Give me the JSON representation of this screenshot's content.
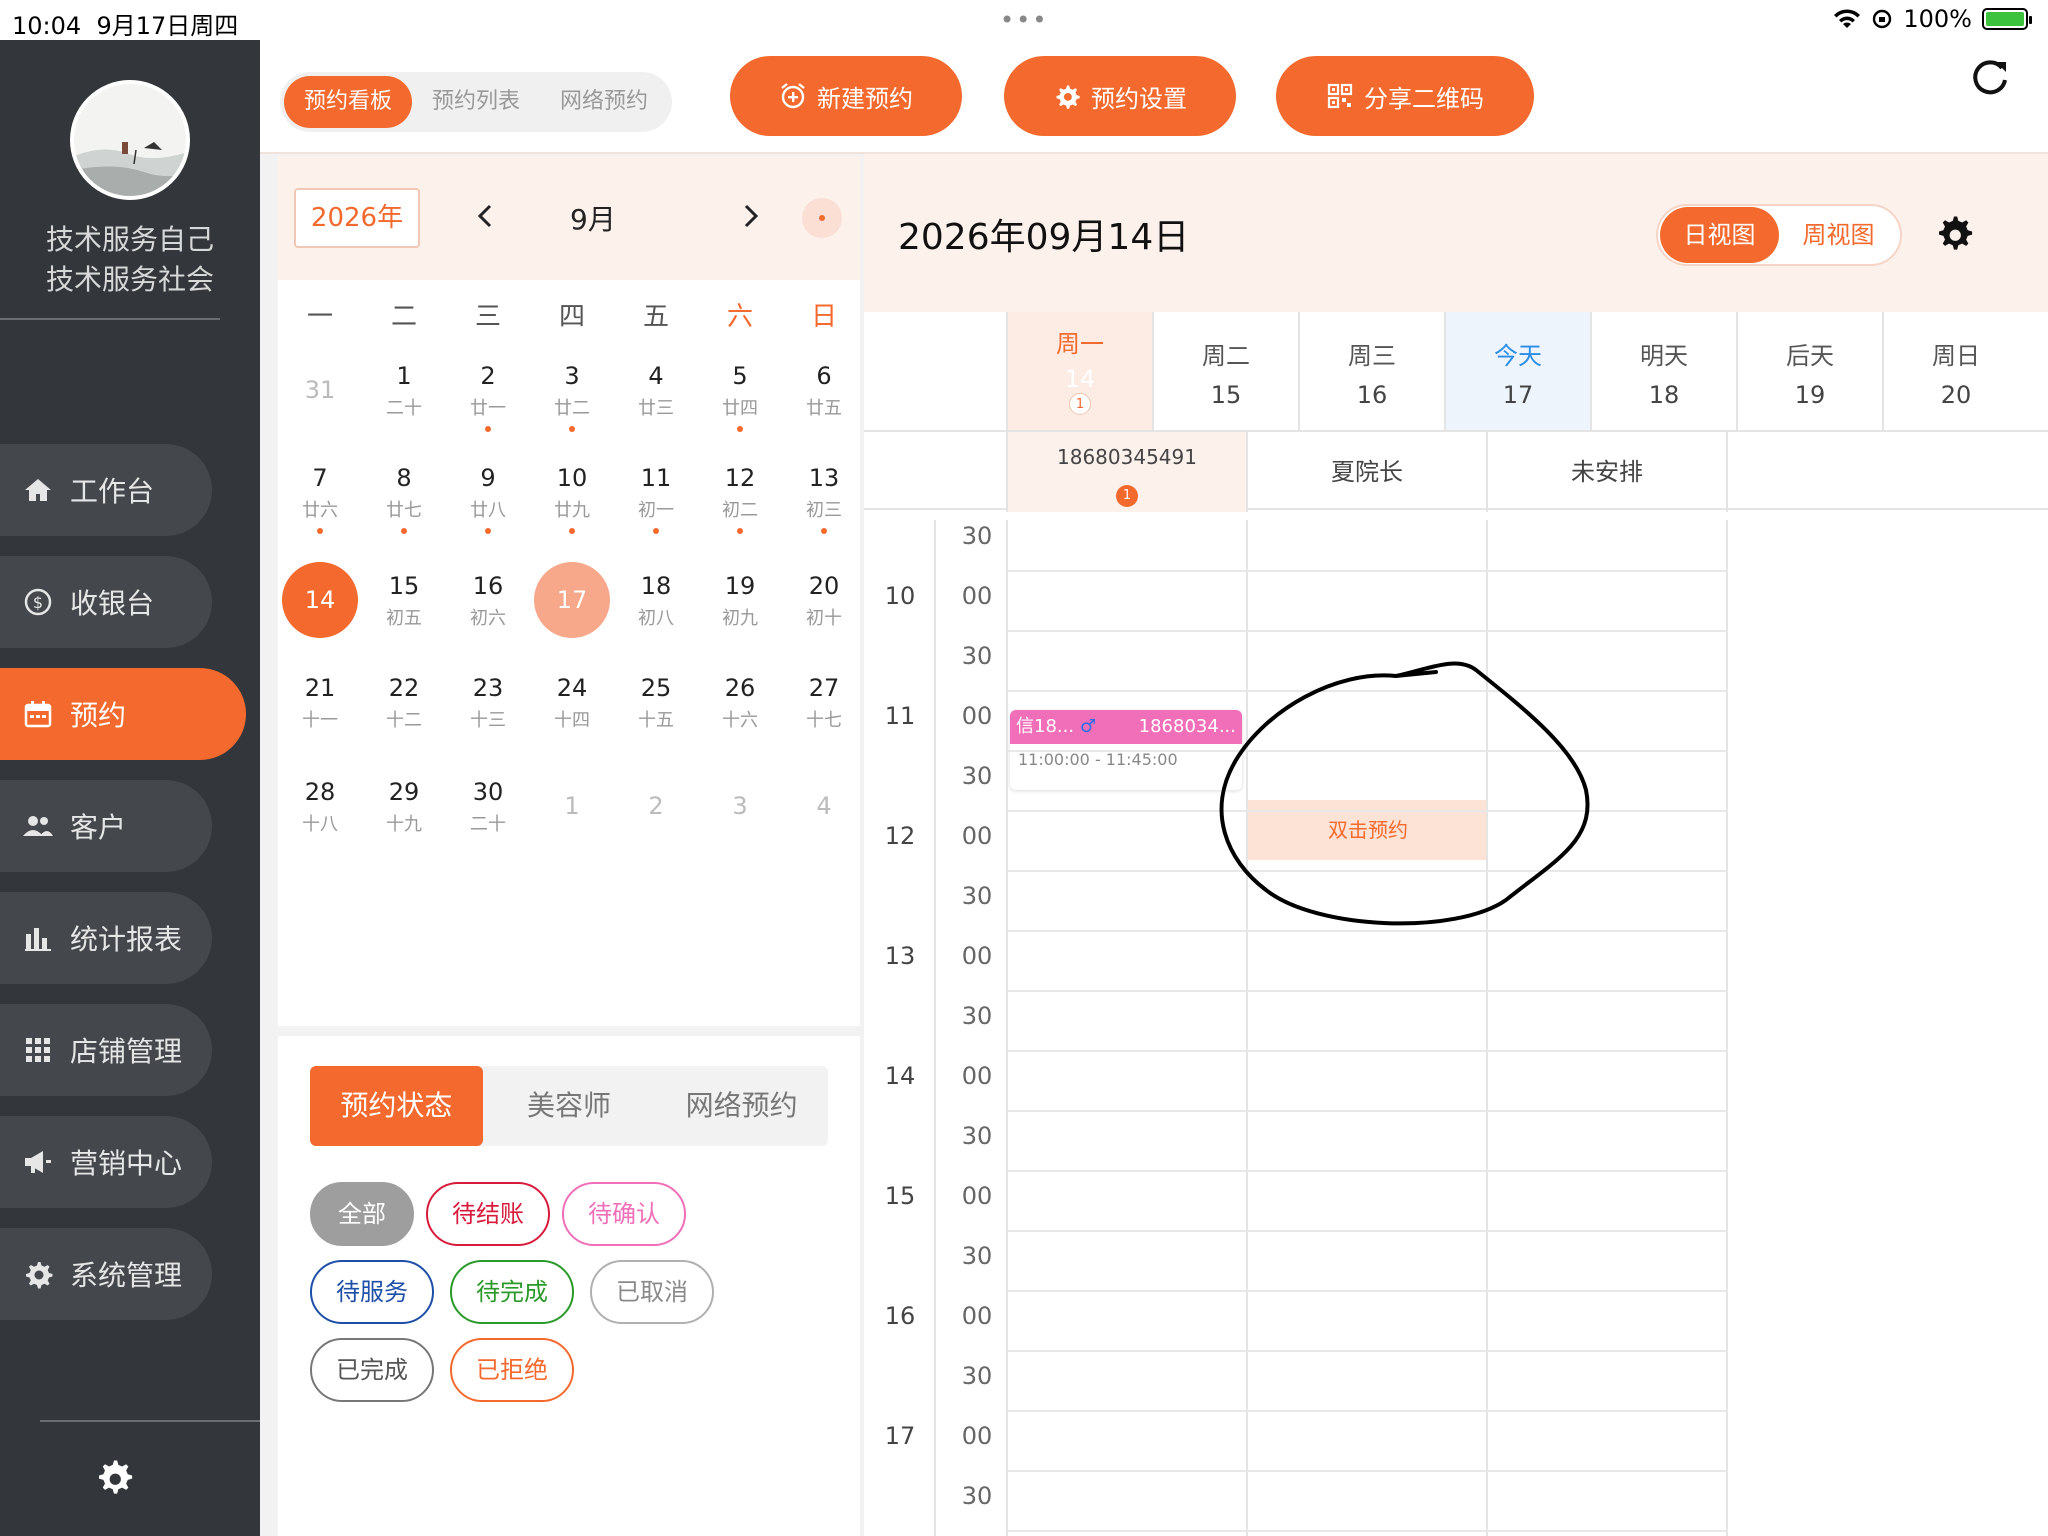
{
  "status_bar": {
    "time": "10:04",
    "date": "9月17日周四",
    "dots": "•••",
    "battery": "100%"
  },
  "sidebar": {
    "store_name_line1": "技术服务自己",
    "store_name_line2": "技术服务社会",
    "items": [
      {
        "label": "工作台",
        "icon": "home-icon"
      },
      {
        "label": "收银台",
        "icon": "dollar-icon"
      },
      {
        "label": "预约",
        "icon": "calendar-icon",
        "active": true
      },
      {
        "label": "客户",
        "icon": "people-icon"
      },
      {
        "label": "统计报表",
        "icon": "bar-chart-icon"
      },
      {
        "label": "店铺管理",
        "icon": "grid-icon"
      },
      {
        "label": "营销中心",
        "icon": "megaphone-icon"
      },
      {
        "label": "系统管理",
        "icon": "gear-icon"
      }
    ]
  },
  "topbar": {
    "tabs": [
      "预约看板",
      "预约列表",
      "网络预约"
    ],
    "active_tab": "预约看板",
    "new_booking": "新建预约",
    "booking_settings": "预约设置",
    "share_qr": "分享二维码"
  },
  "calendar": {
    "year": "2026年",
    "month": "9月",
    "weekdays": [
      "一",
      "二",
      "三",
      "四",
      "五",
      "六",
      "日"
    ],
    "weeks": [
      [
        {
          "n": "31",
          "other": true
        },
        {
          "n": "1",
          "l": "二十"
        },
        {
          "n": "2",
          "l": "廿一",
          "dot": true
        },
        {
          "n": "3",
          "l": "廿二",
          "dot": true
        },
        {
          "n": "4",
          "l": "廿三"
        },
        {
          "n": "5",
          "l": "廿四",
          "dot": true
        },
        {
          "n": "6",
          "l": "廿五"
        }
      ],
      [
        {
          "n": "7",
          "l": "廿六",
          "dot": true
        },
        {
          "n": "8",
          "l": "廿七",
          "dot": true
        },
        {
          "n": "9",
          "l": "廿八",
          "dot": true
        },
        {
          "n": "10",
          "l": "廿九",
          "dot": true
        },
        {
          "n": "11",
          "l": "初一",
          "dot": true
        },
        {
          "n": "12",
          "l": "初二",
          "dot": true
        },
        {
          "n": "13",
          "l": "初三",
          "dot": true
        }
      ],
      [
        {
          "n": "14",
          "selected": true
        },
        {
          "n": "15",
          "l": "初五"
        },
        {
          "n": "16",
          "l": "初六"
        },
        {
          "n": "17",
          "today": true
        },
        {
          "n": "18",
          "l": "初八"
        },
        {
          "n": "19",
          "l": "初九"
        },
        {
          "n": "20",
          "l": "初十"
        }
      ],
      [
        {
          "n": "21",
          "l": "十一"
        },
        {
          "n": "22",
          "l": "十二"
        },
        {
          "n": "23",
          "l": "十三"
        },
        {
          "n": "24",
          "l": "十四"
        },
        {
          "n": "25",
          "l": "十五"
        },
        {
          "n": "26",
          "l": "十六"
        },
        {
          "n": "27",
          "l": "十七"
        }
      ],
      [
        {
          "n": "28",
          "l": "十八"
        },
        {
          "n": "29",
          "l": "十九"
        },
        {
          "n": "30",
          "l": "二十"
        },
        {
          "n": "1",
          "other": true
        },
        {
          "n": "2",
          "other": true
        },
        {
          "n": "3",
          "other": true
        },
        {
          "n": "4",
          "other": true
        }
      ]
    ]
  },
  "filters": {
    "tabs": [
      "预约状态",
      "美容师",
      "网络预约"
    ],
    "chips": [
      {
        "label": "全部",
        "color": "#ffffff",
        "border": "#9e9e9e",
        "bg": "#9e9e9e"
      },
      {
        "label": "待结账",
        "color": "#d81b3c",
        "border": "#d81b3c",
        "bg": "#ffffff"
      },
      {
        "label": "待确认",
        "color": "#f06fb8",
        "border": "#f06fb8",
        "bg": "#ffffff"
      },
      {
        "label": "待服务",
        "color": "#1e4fa8",
        "border": "#1e4fa8",
        "bg": "#ffffff"
      },
      {
        "label": "待完成",
        "color": "#2a9a2a",
        "border": "#2a9a2a",
        "bg": "#ffffff"
      },
      {
        "label": "已取消",
        "color": "#8a8a8a",
        "border": "#b0b0b0",
        "bg": "#ffffff"
      },
      {
        "label": "已完成",
        "color": "#555555",
        "border": "#777777",
        "bg": "#ffffff"
      },
      {
        "label": "已拒绝",
        "color": "#f46a2e",
        "border": "#f46a2e",
        "bg": "#ffffff"
      }
    ]
  },
  "schedule": {
    "date_title": "2026年09月14日",
    "view_day": "日视图",
    "view_week": "周视图",
    "week": [
      {
        "w": "周一",
        "d": "14",
        "badge": "1"
      },
      {
        "w": "周二",
        "d": "15"
      },
      {
        "w": "周三",
        "d": "16"
      },
      {
        "w": "今天",
        "d": "17"
      },
      {
        "w": "明天",
        "d": "18"
      },
      {
        "w": "后天",
        "d": "19"
      },
      {
        "w": "周日",
        "d": "20"
      }
    ],
    "staff": [
      {
        "name": "18680345491",
        "badge": "1"
      },
      {
        "name": "夏院长"
      },
      {
        "name": "未安排"
      }
    ],
    "times": [
      {
        "h": "",
        "m": "30"
      },
      {
        "h": "10",
        "m": "00"
      },
      {
        "h": "",
        "m": "30"
      },
      {
        "h": "11",
        "m": "00"
      },
      {
        "h": "",
        "m": "30"
      },
      {
        "h": "12",
        "m": "00"
      },
      {
        "h": "",
        "m": "30"
      },
      {
        "h": "13",
        "m": "00"
      },
      {
        "h": "",
        "m": "30"
      },
      {
        "h": "14",
        "m": "00"
      },
      {
        "h": "",
        "m": "30"
      },
      {
        "h": "15",
        "m": "00"
      },
      {
        "h": "",
        "m": "30"
      },
      {
        "h": "16",
        "m": "00"
      },
      {
        "h": "",
        "m": "30"
      },
      {
        "h": "17",
        "m": "00"
      },
      {
        "h": "",
        "m": "30"
      }
    ],
    "appointment": {
      "name": "信18...",
      "gender": "♂",
      "phone": "1868034...",
      "time": "11:00:00 - 11:45:00"
    },
    "hint": "双击预约"
  },
  "colors": {
    "accent": "#f46a2e",
    "sidebar": "#33363b"
  }
}
